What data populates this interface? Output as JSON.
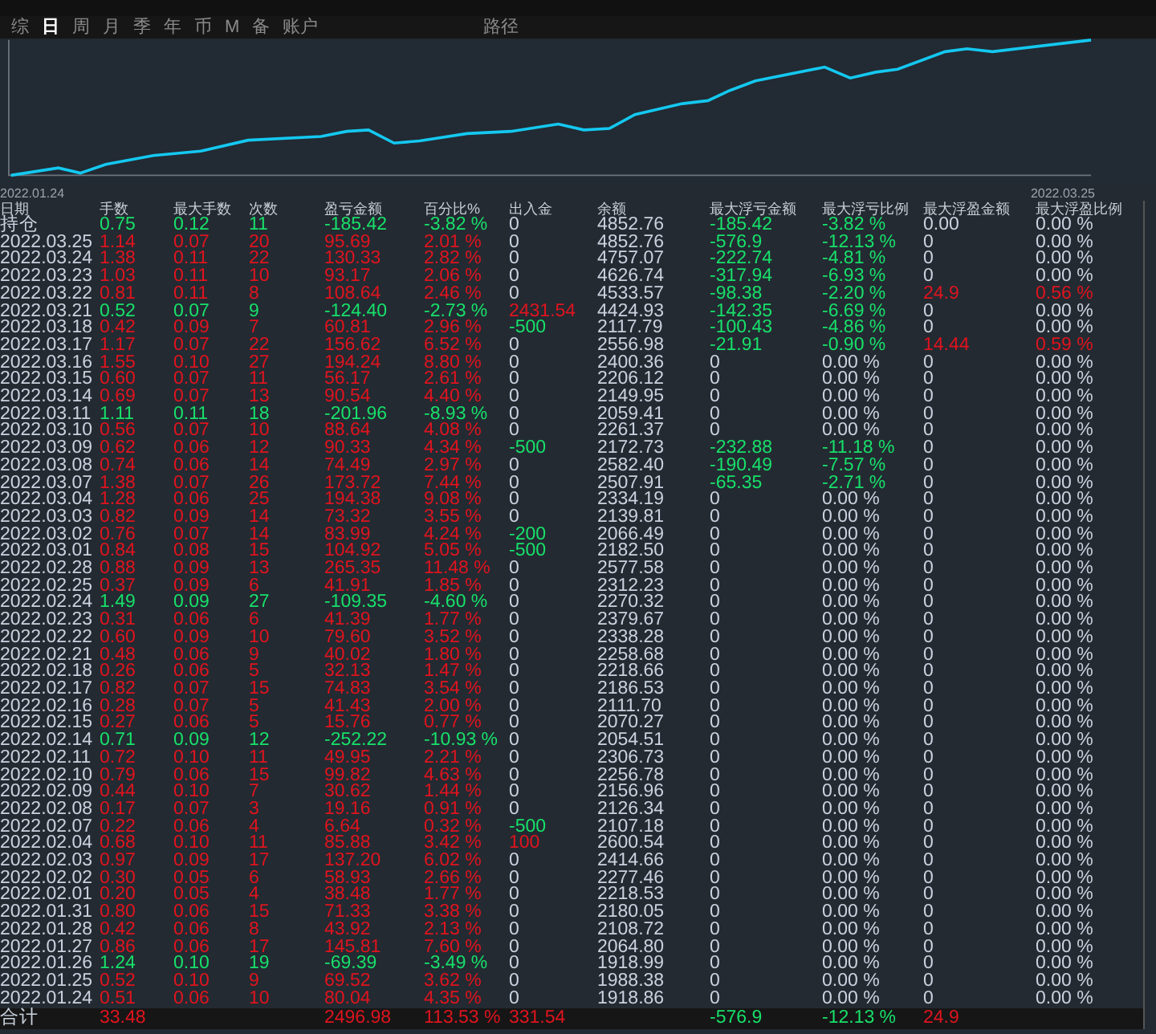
{
  "tabs": [
    {
      "label": "综",
      "selected": false
    },
    {
      "label": "日",
      "selected": true
    },
    {
      "label": "周",
      "selected": false
    },
    {
      "label": "月",
      "selected": false
    },
    {
      "label": "季",
      "selected": false
    },
    {
      "label": "年",
      "selected": false
    },
    {
      "label": "币",
      "selected": false
    },
    {
      "label": "M",
      "selected": false
    },
    {
      "label": "备",
      "selected": false
    },
    {
      "label": "账户",
      "selected": false
    }
  ],
  "path_label": "路径",
  "chart": {
    "start_label": "2022.01.24",
    "end_label": "2022.03.25"
  },
  "table": {
    "columns": [
      "日期",
      "手数",
      "最大手数",
      "次数",
      "盈亏金额",
      "百分比%",
      "出入金",
      "余额",
      "最大浮亏金额",
      "最大浮亏比例",
      "最大浮盈金额",
      "最大浮盈比例"
    ],
    "rows": [
      {
        "cells": [
          "持仓",
          "0.75",
          "0.12",
          "11",
          "-185.42",
          "-3.82 %",
          "0",
          "4852.76",
          "-185.42",
          "-3.82 %",
          "0.00",
          "0.00 %"
        ],
        "loss": true,
        "inflow": false,
        "outflow": false,
        "drawdown": true,
        "runup": false
      },
      {
        "cells": [
          "2022.03.25",
          "1.14",
          "0.07",
          "20",
          "95.69",
          "2.01 %",
          "0",
          "4852.76",
          "-576.9",
          "-12.13 %",
          "0",
          "0.00 %"
        ],
        "loss": false,
        "inflow": false,
        "outflow": false,
        "drawdown": true,
        "runup": false
      },
      {
        "cells": [
          "2022.03.24",
          "1.38",
          "0.11",
          "22",
          "130.33",
          "2.82 %",
          "0",
          "4757.07",
          "-222.74",
          "-4.81 %",
          "0",
          "0.00 %"
        ],
        "loss": false,
        "inflow": false,
        "outflow": false,
        "drawdown": true,
        "runup": false
      },
      {
        "cells": [
          "2022.03.23",
          "1.03",
          "0.11",
          "10",
          "93.17",
          "2.06 %",
          "0",
          "4626.74",
          "-317.94",
          "-6.93 %",
          "0",
          "0.00 %"
        ],
        "loss": false,
        "inflow": false,
        "outflow": false,
        "drawdown": true,
        "runup": false
      },
      {
        "cells": [
          "2022.03.22",
          "0.81",
          "0.11",
          "8",
          "108.64",
          "2.46 %",
          "0",
          "4533.57",
          "-98.38",
          "-2.20 %",
          "24.9",
          "0.56 %"
        ],
        "loss": false,
        "inflow": false,
        "outflow": false,
        "drawdown": true,
        "runup": true
      },
      {
        "cells": [
          "2022.03.21",
          "0.52",
          "0.07",
          "9",
          "-124.40",
          "-2.73 %",
          "2431.54",
          "4424.93",
          "-142.35",
          "-6.69 %",
          "0",
          "0.00 %"
        ],
        "loss": true,
        "inflow": true,
        "outflow": false,
        "drawdown": true,
        "runup": false
      },
      {
        "cells": [
          "2022.03.18",
          "0.42",
          "0.09",
          "7",
          "60.81",
          "2.96 %",
          "-500",
          "2117.79",
          "-100.43",
          "-4.86 %",
          "0",
          "0.00 %"
        ],
        "loss": false,
        "inflow": false,
        "outflow": true,
        "drawdown": true,
        "runup": false
      },
      {
        "cells": [
          "2022.03.17",
          "1.17",
          "0.07",
          "22",
          "156.62",
          "6.52 %",
          "0",
          "2556.98",
          "-21.91",
          "-0.90 %",
          "14.44",
          "0.59 %"
        ],
        "loss": false,
        "inflow": false,
        "outflow": false,
        "drawdown": true,
        "runup": true
      },
      {
        "cells": [
          "2022.03.16",
          "1.55",
          "0.10",
          "27",
          "194.24",
          "8.80 %",
          "0",
          "2400.36",
          "0",
          "0.00 %",
          "0",
          "0.00 %"
        ],
        "loss": false,
        "inflow": false,
        "outflow": false,
        "drawdown": false,
        "runup": false
      },
      {
        "cells": [
          "2022.03.15",
          "0.60",
          "0.07",
          "11",
          "56.17",
          "2.61 %",
          "0",
          "2206.12",
          "0",
          "0.00 %",
          "0",
          "0.00 %"
        ],
        "loss": false,
        "inflow": false,
        "outflow": false,
        "drawdown": false,
        "runup": false
      },
      {
        "cells": [
          "2022.03.14",
          "0.69",
          "0.07",
          "13",
          "90.54",
          "4.40 %",
          "0",
          "2149.95",
          "0",
          "0.00 %",
          "0",
          "0.00 %"
        ],
        "loss": false,
        "inflow": false,
        "outflow": false,
        "drawdown": false,
        "runup": false
      },
      {
        "cells": [
          "2022.03.11",
          "1.11",
          "0.11",
          "18",
          "-201.96",
          "-8.93 %",
          "0",
          "2059.41",
          "0",
          "0.00 %",
          "0",
          "0.00 %"
        ],
        "loss": true,
        "inflow": false,
        "outflow": false,
        "drawdown": false,
        "runup": false
      },
      {
        "cells": [
          "2022.03.10",
          "0.56",
          "0.07",
          "10",
          "88.64",
          "4.08 %",
          "0",
          "2261.37",
          "0",
          "0.00 %",
          "0",
          "0.00 %"
        ],
        "loss": false,
        "inflow": false,
        "outflow": false,
        "drawdown": false,
        "runup": false
      },
      {
        "cells": [
          "2022.03.09",
          "0.62",
          "0.06",
          "12",
          "90.33",
          "4.34 %",
          "-500",
          "2172.73",
          "-232.88",
          "-11.18 %",
          "0",
          "0.00 %"
        ],
        "loss": false,
        "inflow": false,
        "outflow": true,
        "drawdown": true,
        "runup": false
      },
      {
        "cells": [
          "2022.03.08",
          "0.74",
          "0.06",
          "14",
          "74.49",
          "2.97 %",
          "0",
          "2582.40",
          "-190.49",
          "-7.57 %",
          "0",
          "0.00 %"
        ],
        "loss": false,
        "inflow": false,
        "outflow": false,
        "drawdown": true,
        "runup": false
      },
      {
        "cells": [
          "2022.03.07",
          "1.38",
          "0.07",
          "26",
          "173.72",
          "7.44 %",
          "0",
          "2507.91",
          "-65.35",
          "-2.71 %",
          "0",
          "0.00 %"
        ],
        "loss": false,
        "inflow": false,
        "outflow": false,
        "drawdown": true,
        "runup": false
      },
      {
        "cells": [
          "2022.03.04",
          "1.28",
          "0.06",
          "25",
          "194.38",
          "9.08 %",
          "0",
          "2334.19",
          "0",
          "0.00 %",
          "0",
          "0.00 %"
        ],
        "loss": false,
        "inflow": false,
        "outflow": false,
        "drawdown": false,
        "runup": false
      },
      {
        "cells": [
          "2022.03.03",
          "0.82",
          "0.09",
          "14",
          "73.32",
          "3.55 %",
          "0",
          "2139.81",
          "0",
          "0.00 %",
          "0",
          "0.00 %"
        ],
        "loss": false,
        "inflow": false,
        "outflow": false,
        "drawdown": false,
        "runup": false
      },
      {
        "cells": [
          "2022.03.02",
          "0.76",
          "0.07",
          "14",
          "83.99",
          "4.24 %",
          "-200",
          "2066.49",
          "0",
          "0.00 %",
          "0",
          "0.00 %"
        ],
        "loss": false,
        "inflow": false,
        "outflow": true,
        "drawdown": false,
        "runup": false
      },
      {
        "cells": [
          "2022.03.01",
          "0.84",
          "0.08",
          "15",
          "104.92",
          "5.05 %",
          "-500",
          "2182.50",
          "0",
          "0.00 %",
          "0",
          "0.00 %"
        ],
        "loss": false,
        "inflow": false,
        "outflow": true,
        "drawdown": false,
        "runup": false
      },
      {
        "cells": [
          "2022.02.28",
          "0.88",
          "0.09",
          "13",
          "265.35",
          "11.48 %",
          "0",
          "2577.58",
          "0",
          "0.00 %",
          "0",
          "0.00 %"
        ],
        "loss": false,
        "inflow": false,
        "outflow": false,
        "drawdown": false,
        "runup": false
      },
      {
        "cells": [
          "2022.02.25",
          "0.37",
          "0.09",
          "6",
          "41.91",
          "1.85 %",
          "0",
          "2312.23",
          "0",
          "0.00 %",
          "0",
          "0.00 %"
        ],
        "loss": false,
        "inflow": false,
        "outflow": false,
        "drawdown": false,
        "runup": false
      },
      {
        "cells": [
          "2022.02.24",
          "1.49",
          "0.09",
          "27",
          "-109.35",
          "-4.60 %",
          "0",
          "2270.32",
          "0",
          "0.00 %",
          "0",
          "0.00 %"
        ],
        "loss": true,
        "inflow": false,
        "outflow": false,
        "drawdown": false,
        "runup": false
      },
      {
        "cells": [
          "2022.02.23",
          "0.31",
          "0.06",
          "6",
          "41.39",
          "1.77 %",
          "0",
          "2379.67",
          "0",
          "0.00 %",
          "0",
          "0.00 %"
        ],
        "loss": false,
        "inflow": false,
        "outflow": false,
        "drawdown": false,
        "runup": false
      },
      {
        "cells": [
          "2022.02.22",
          "0.60",
          "0.09",
          "10",
          "79.60",
          "3.52 %",
          "0",
          "2338.28",
          "0",
          "0.00 %",
          "0",
          "0.00 %"
        ],
        "loss": false,
        "inflow": false,
        "outflow": false,
        "drawdown": false,
        "runup": false
      },
      {
        "cells": [
          "2022.02.21",
          "0.48",
          "0.06",
          "9",
          "40.02",
          "1.80 %",
          "0",
          "2258.68",
          "0",
          "0.00 %",
          "0",
          "0.00 %"
        ],
        "loss": false,
        "inflow": false,
        "outflow": false,
        "drawdown": false,
        "runup": false
      },
      {
        "cells": [
          "2022.02.18",
          "0.26",
          "0.06",
          "5",
          "32.13",
          "1.47 %",
          "0",
          "2218.66",
          "0",
          "0.00 %",
          "0",
          "0.00 %"
        ],
        "loss": false,
        "inflow": false,
        "outflow": false,
        "drawdown": false,
        "runup": false
      },
      {
        "cells": [
          "2022.02.17",
          "0.82",
          "0.07",
          "15",
          "74.83",
          "3.54 %",
          "0",
          "2186.53",
          "0",
          "0.00 %",
          "0",
          "0.00 %"
        ],
        "loss": false,
        "inflow": false,
        "outflow": false,
        "drawdown": false,
        "runup": false
      },
      {
        "cells": [
          "2022.02.16",
          "0.28",
          "0.07",
          "5",
          "41.43",
          "2.00 %",
          "0",
          "2111.70",
          "0",
          "0.00 %",
          "0",
          "0.00 %"
        ],
        "loss": false,
        "inflow": false,
        "outflow": false,
        "drawdown": false,
        "runup": false
      },
      {
        "cells": [
          "2022.02.15",
          "0.27",
          "0.06",
          "5",
          "15.76",
          "0.77 %",
          "0",
          "2070.27",
          "0",
          "0.00 %",
          "0",
          "0.00 %"
        ],
        "loss": false,
        "inflow": false,
        "outflow": false,
        "drawdown": false,
        "runup": false
      },
      {
        "cells": [
          "2022.02.14",
          "0.71",
          "0.09",
          "12",
          "-252.22",
          "-10.93 %",
          "0",
          "2054.51",
          "0",
          "0.00 %",
          "0",
          "0.00 %"
        ],
        "loss": true,
        "inflow": false,
        "outflow": false,
        "drawdown": false,
        "runup": false
      },
      {
        "cells": [
          "2022.02.11",
          "0.72",
          "0.10",
          "11",
          "49.95",
          "2.21 %",
          "0",
          "2306.73",
          "0",
          "0.00 %",
          "0",
          "0.00 %"
        ],
        "loss": false,
        "inflow": false,
        "outflow": false,
        "drawdown": false,
        "runup": false
      },
      {
        "cells": [
          "2022.02.10",
          "0.79",
          "0.06",
          "15",
          "99.82",
          "4.63 %",
          "0",
          "2256.78",
          "0",
          "0.00 %",
          "0",
          "0.00 %"
        ],
        "loss": false,
        "inflow": false,
        "outflow": false,
        "drawdown": false,
        "runup": false
      },
      {
        "cells": [
          "2022.02.09",
          "0.44",
          "0.10",
          "7",
          "30.62",
          "1.44 %",
          "0",
          "2156.96",
          "0",
          "0.00 %",
          "0",
          "0.00 %"
        ],
        "loss": false,
        "inflow": false,
        "outflow": false,
        "drawdown": false,
        "runup": false
      },
      {
        "cells": [
          "2022.02.08",
          "0.17",
          "0.07",
          "3",
          "19.16",
          "0.91 %",
          "0",
          "2126.34",
          "0",
          "0.00 %",
          "0",
          "0.00 %"
        ],
        "loss": false,
        "inflow": false,
        "outflow": false,
        "drawdown": false,
        "runup": false
      },
      {
        "cells": [
          "2022.02.07",
          "0.22",
          "0.06",
          "4",
          "6.64",
          "0.32 %",
          "-500",
          "2107.18",
          "0",
          "0.00 %",
          "0",
          "0.00 %"
        ],
        "loss": false,
        "inflow": false,
        "outflow": true,
        "drawdown": false,
        "runup": false
      },
      {
        "cells": [
          "2022.02.04",
          "0.68",
          "0.10",
          "11",
          "85.88",
          "3.42 %",
          "100",
          "2600.54",
          "0",
          "0.00 %",
          "0",
          "0.00 %"
        ],
        "loss": false,
        "inflow": true,
        "outflow": false,
        "drawdown": false,
        "runup": false
      },
      {
        "cells": [
          "2022.02.03",
          "0.97",
          "0.09",
          "17",
          "137.20",
          "6.02 %",
          "0",
          "2414.66",
          "0",
          "0.00 %",
          "0",
          "0.00 %"
        ],
        "loss": false,
        "inflow": false,
        "outflow": false,
        "drawdown": false,
        "runup": false
      },
      {
        "cells": [
          "2022.02.02",
          "0.30",
          "0.05",
          "6",
          "58.93",
          "2.66 %",
          "0",
          "2277.46",
          "0",
          "0.00 %",
          "0",
          "0.00 %"
        ],
        "loss": false,
        "inflow": false,
        "outflow": false,
        "drawdown": false,
        "runup": false
      },
      {
        "cells": [
          "2022.02.01",
          "0.20",
          "0.05",
          "4",
          "38.48",
          "1.77 %",
          "0",
          "2218.53",
          "0",
          "0.00 %",
          "0",
          "0.00 %"
        ],
        "loss": false,
        "inflow": false,
        "outflow": false,
        "drawdown": false,
        "runup": false
      },
      {
        "cells": [
          "2022.01.31",
          "0.80",
          "0.06",
          "15",
          "71.33",
          "3.38 %",
          "0",
          "2180.05",
          "0",
          "0.00 %",
          "0",
          "0.00 %"
        ],
        "loss": false,
        "inflow": false,
        "outflow": false,
        "drawdown": false,
        "runup": false
      },
      {
        "cells": [
          "2022.01.28",
          "0.42",
          "0.06",
          "8",
          "43.92",
          "2.13 %",
          "0",
          "2108.72",
          "0",
          "0.00 %",
          "0",
          "0.00 %"
        ],
        "loss": false,
        "inflow": false,
        "outflow": false,
        "drawdown": false,
        "runup": false
      },
      {
        "cells": [
          "2022.01.27",
          "0.86",
          "0.06",
          "17",
          "145.81",
          "7.60 %",
          "0",
          "2064.80",
          "0",
          "0.00 %",
          "0",
          "0.00 %"
        ],
        "loss": false,
        "inflow": false,
        "outflow": false,
        "drawdown": false,
        "runup": false
      },
      {
        "cells": [
          "2022.01.26",
          "1.24",
          "0.10",
          "19",
          "-69.39",
          "-3.49 %",
          "0",
          "1918.99",
          "0",
          "0.00 %",
          "0",
          "0.00 %"
        ],
        "loss": true,
        "inflow": false,
        "outflow": false,
        "drawdown": false,
        "runup": false
      },
      {
        "cells": [
          "2022.01.25",
          "0.52",
          "0.10",
          "9",
          "69.52",
          "3.62 %",
          "0",
          "1988.38",
          "0",
          "0.00 %",
          "0",
          "0.00 %"
        ],
        "loss": false,
        "inflow": false,
        "outflow": false,
        "drawdown": false,
        "runup": false
      },
      {
        "cells": [
          "2022.01.24",
          "0.51",
          "0.06",
          "10",
          "80.04",
          "4.35 %",
          "0",
          "1918.86",
          "0",
          "0.00 %",
          "0",
          "0.00 %"
        ],
        "loss": false,
        "inflow": false,
        "outflow": false,
        "drawdown": false,
        "runup": false
      }
    ],
    "total": {
      "cells": [
        "合计",
        "33.48",
        null,
        null,
        "2496.98",
        "113.53 %",
        "331.54",
        null,
        "-576.9",
        "-12.13 %",
        "24.9",
        null
      ],
      "loss": false,
      "inflow": true,
      "outflow": false,
      "drawdown": true,
      "runup": true
    }
  }
}
